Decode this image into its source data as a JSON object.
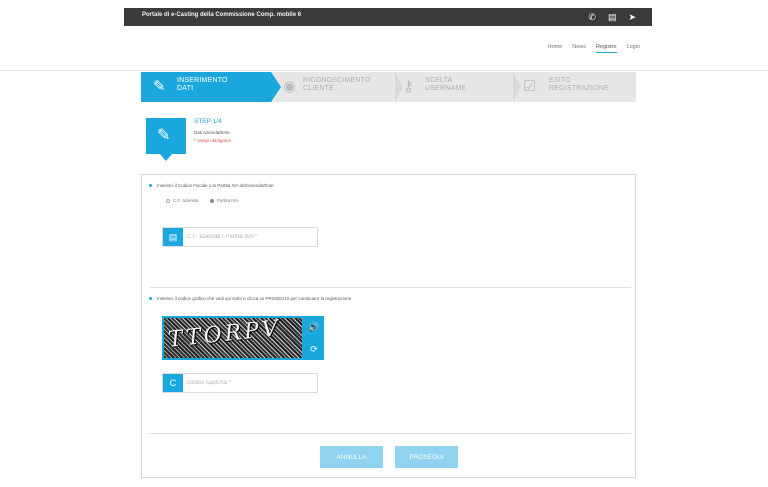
{
  "topbar": {
    "title": "Portale di e-Casting della Commissione Comp. mobile 6",
    "icons": [
      "phone-icon",
      "print-icon",
      "send-icon"
    ],
    "icon_glyphs": [
      "✆",
      "▤",
      "➤"
    ]
  },
  "nav": {
    "items": [
      "Home",
      "News",
      "Registro",
      "Login"
    ],
    "active": "Registro"
  },
  "steps": [
    {
      "label_1": "INSERIMENTO",
      "label_2": "DATI",
      "icon": "✎",
      "icon_name": "edit-form-icon",
      "active": true
    },
    {
      "label_1": "RICONOSCIMENTO",
      "label_2": "CLIENTE",
      "icon": "◉",
      "icon_name": "fingerprint-icon",
      "active": false
    },
    {
      "label_1": "SCELTA",
      "label_2": "USERNAME",
      "icon": "⚷",
      "icon_name": "key-icon",
      "active": false
    },
    {
      "label_1": "ESITO",
      "label_2": "REGISTRAZIONE",
      "icon": "☑",
      "icon_name": "checkbox-icon",
      "active": false
    }
  ],
  "step_info": {
    "title": "STEP 1/4",
    "subtitle": "Dati Azienda/Ente",
    "required_note": "* campi obbligatori"
  },
  "section1": {
    "question": "Inserisci il Codice Fiscale o la Partita IVA dell'azienda/Ente",
    "radio_options": [
      "C.F. azienda",
      "Partita IVA"
    ],
    "radio_selected": "Partita IVA",
    "input_placeholder": "C.F. azienda / Partita IVA *"
  },
  "section2": {
    "question": "Inserisci il codice grafico che vedi qui sotto e clicca su PROSEGUI per continuare la registrazione",
    "captcha_text": "TTORPV",
    "input_placeholder": "codice captcha *"
  },
  "buttons": {
    "cancel": "ANNULLA",
    "proceed": "PROSEGUI"
  }
}
